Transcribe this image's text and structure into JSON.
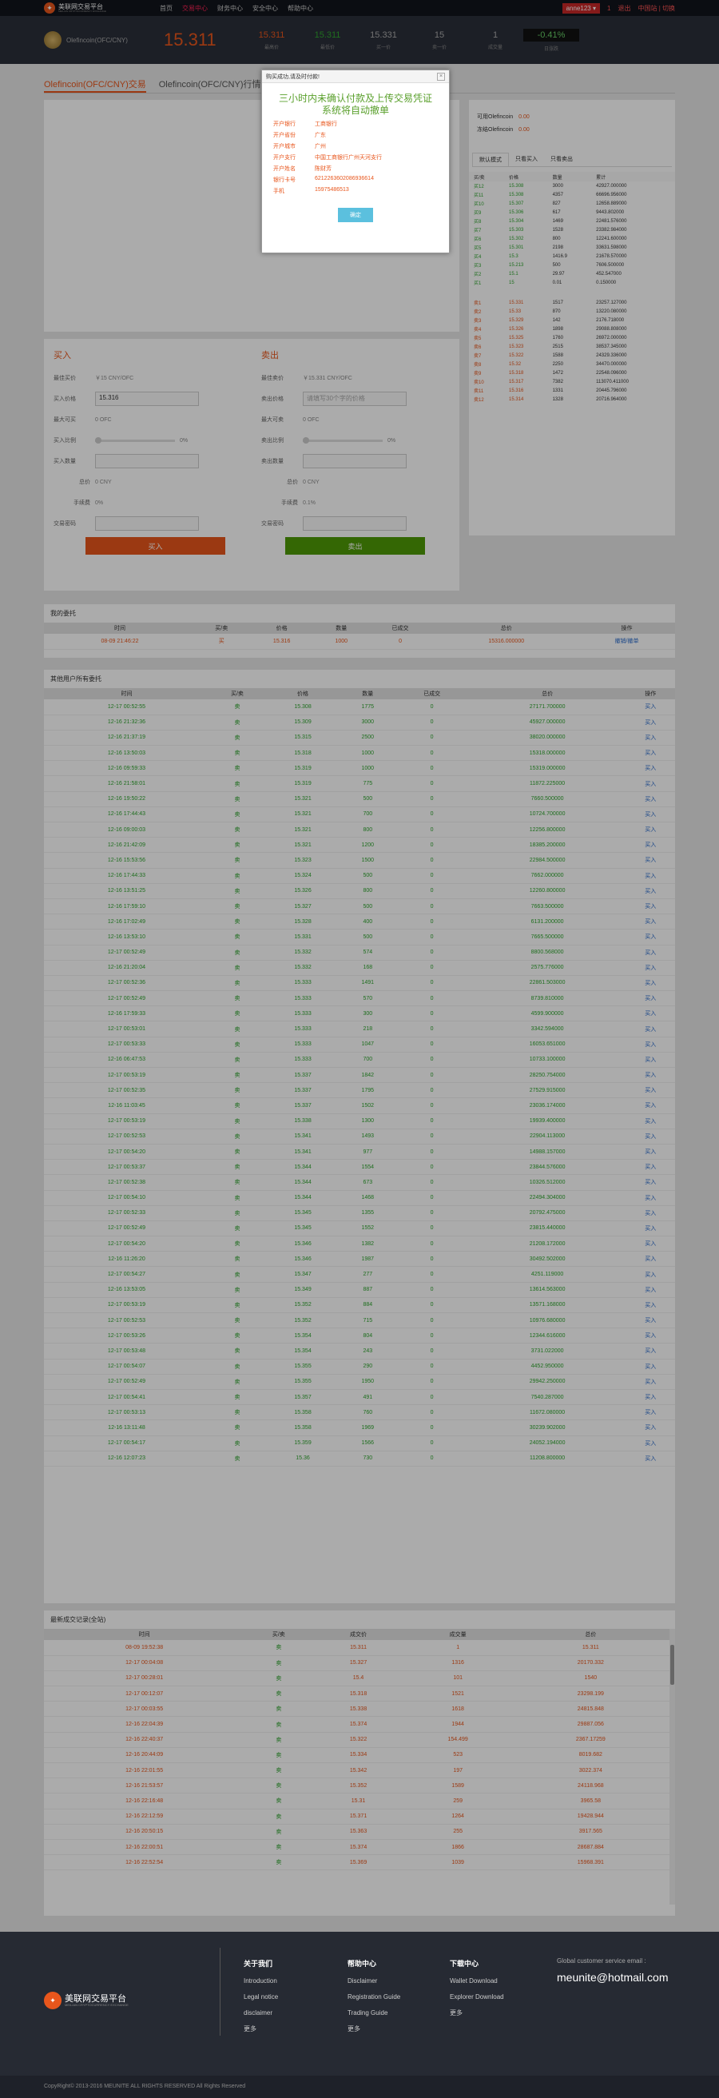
{
  "topbar": {
    "logo_text": "美联网交易平台",
    "logo_sub": "MEILIAN CRYPTOCURRENCY EXCHANGE",
    "nav": [
      "首页",
      "交易中心",
      "财务中心",
      "安全中心",
      "帮助中心"
    ],
    "user": "anne123",
    "link1": "1",
    "logout": "退出",
    "lang": "中国站 | 切换",
    "hex_user_bg": "#c62828"
  },
  "pricebar": {
    "coin": "Olefincoin(OFC/CNY)",
    "price": "15.311",
    "stats": [
      {
        "v": "15.311",
        "l": "最高价",
        "c": "red"
      },
      {
        "v": "15.311",
        "l": "最低价",
        "c": "green"
      },
      {
        "v": "15.331",
        "l": "买一价",
        "c": "gray"
      },
      {
        "v": "15",
        "l": "卖一价",
        "c": "gray"
      },
      {
        "v": "1",
        "l": "成交量",
        "c": "gray"
      },
      {
        "v": "-0.41%",
        "l": "日涨跌",
        "c": "pct"
      }
    ]
  },
  "tabs": [
    "Olefincoin(OFC/CNY)交易",
    "Olefincoin(OFC/CNY)行情"
  ],
  "modal": {
    "title": "购买成功,请及时付款!",
    "close": "×",
    "notice": "三小时内未确认付款及上传交易凭证系统将自动撤单",
    "fields": [
      {
        "k": "开户银行",
        "v": "工商银行"
      },
      {
        "k": "开户省份",
        "v": "广东"
      },
      {
        "k": "开户城市",
        "v": "广州"
      },
      {
        "k": "开户支行",
        "v": "中国工商银行广州天河支行"
      },
      {
        "k": "开户姓名",
        "v": "陈财芳"
      },
      {
        "k": "银行卡号",
        "v": "6212263602086936614"
      },
      {
        "k": "手机",
        "v": "15975486513"
      }
    ],
    "ok": "确定"
  },
  "balance": {
    "rows": [
      {
        "k": "可用Olefincoin",
        "v": "0.00"
      },
      {
        "k": "冻结Olefincoin",
        "v": "0.00"
      }
    ]
  },
  "ob_tabs": [
    "默认模式",
    "只看买入",
    "只看卖出"
  ],
  "ob_headers": [
    "买/卖",
    "价格",
    "数量",
    "累计"
  ],
  "ob_buy": [
    [
      "买12",
      "15.308",
      "3000",
      "42927.000000"
    ],
    [
      "买11",
      "15.308",
      "4357",
      "66696.956000"
    ],
    [
      "买10",
      "15.307",
      "827",
      "12658.889000"
    ],
    [
      "买9",
      "15.306",
      "617",
      "9443.802000"
    ],
    [
      "买8",
      "15.304",
      "1469",
      "22481.576000"
    ],
    [
      "买7",
      "15.303",
      "1528",
      "23382.984000"
    ],
    [
      "买6",
      "15.302",
      "800",
      "12241.600000"
    ],
    [
      "买5",
      "15.301",
      "2198",
      "33631.598000"
    ],
    [
      "买4",
      "15.3",
      "1416.9",
      "21678.570000"
    ],
    [
      "买3",
      "15.213",
      "500",
      "7606.500000"
    ],
    [
      "买2",
      "15.1",
      "29.97",
      "452.547000"
    ],
    [
      "买1",
      "15",
      "0.01",
      "0.150000"
    ]
  ],
  "ob_sell": [
    [
      "卖1",
      "15.331",
      "1517",
      "23257.127000"
    ],
    [
      "卖2",
      "15.33",
      "870",
      "13220.080000"
    ],
    [
      "卖3",
      "15.329",
      "142",
      "2176.718000"
    ],
    [
      "卖4",
      "15.326",
      "1898",
      "29088.808000"
    ],
    [
      "卖5",
      "15.325",
      "1760",
      "26972.000000"
    ],
    [
      "卖6",
      "15.323",
      "2515",
      "38537.345000"
    ],
    [
      "卖7",
      "15.322",
      "1588",
      "24329.336000"
    ],
    [
      "卖8",
      "15.32",
      "2250",
      "34470.000000"
    ],
    [
      "卖9",
      "15.318",
      "1472",
      "22548.096000"
    ],
    [
      "卖10",
      "15.317",
      "7382",
      "113070.411000"
    ],
    [
      "卖11",
      "15.316",
      "1331",
      "20445.796000"
    ],
    [
      "卖12",
      "15.314",
      "1328",
      "20716.964000"
    ]
  ],
  "buy_form": {
    "title": "买入",
    "best": "最佳买价",
    "best_val": "￥15 CNY/OFC",
    "price_lbl": "买入价格",
    "price_val": "15.316",
    "max_lbl": "最大可买",
    "max_val": "0 OFC",
    "ratio_lbl": "买入比例",
    "ratio_val": "0%",
    "qty_lbl": "买入数量",
    "total_lbl": "总价",
    "total_val": "0 CNY",
    "fee_lbl": "手续费",
    "fee_val": "0%",
    "pwd_lbl": "交易密码",
    "btn": "买入"
  },
  "sell_form": {
    "title": "卖出",
    "best": "最佳卖价",
    "best_val": "￥15.331 CNY/OFC",
    "price_lbl": "卖出价格",
    "price_ph": "请填写30个字的价格",
    "max_lbl": "最大可卖",
    "max_val": "0 OFC",
    "ratio_lbl": "卖出比例",
    "ratio_val": "0%",
    "qty_lbl": "卖出数量",
    "total_lbl": "总价",
    "total_val": "0 CNY",
    "fee_lbl": "手续费",
    "fee_val": "0.1%",
    "pwd_lbl": "交易密码",
    "btn": "卖出"
  },
  "my_orders": {
    "title": "我的委托",
    "headers": [
      "时间",
      "买/卖",
      "价格",
      "数量",
      "已成交",
      "总价",
      "操作"
    ],
    "rows": [
      [
        "08-09 21:46:22",
        "买",
        "15.316",
        "1000",
        "0",
        "15316.000000",
        "撤销/撤单"
      ]
    ]
  },
  "others": {
    "title": "其他用户所有委托",
    "headers": [
      "时间",
      "买/卖",
      "价格",
      "数量",
      "已成交",
      "总价",
      "操作"
    ],
    "rows": [
      [
        "12-17 00:52:55",
        "卖",
        "15.308",
        "1775",
        "0",
        "27171.700000",
        "买入"
      ],
      [
        "12-16 21:32:36",
        "卖",
        "15.309",
        "3000",
        "0",
        "45927.000000",
        "买入"
      ],
      [
        "12-16 21:37:19",
        "卖",
        "15.315",
        "2500",
        "0",
        "38020.000000",
        "买入"
      ],
      [
        "12-16 13:50:03",
        "卖",
        "15.318",
        "1000",
        "0",
        "15318.000000",
        "买入"
      ],
      [
        "12-16 09:59:33",
        "卖",
        "15.319",
        "1000",
        "0",
        "15319.000000",
        "买入"
      ],
      [
        "12-16 21:58:01",
        "卖",
        "15.319",
        "775",
        "0",
        "11872.225000",
        "买入"
      ],
      [
        "12-16 19:50:22",
        "卖",
        "15.321",
        "500",
        "0",
        "7660.500000",
        "买入"
      ],
      [
        "12-16 17:44:43",
        "卖",
        "15.321",
        "700",
        "0",
        "10724.700000",
        "买入"
      ],
      [
        "12-16 09:00:03",
        "卖",
        "15.321",
        "800",
        "0",
        "12256.800000",
        "买入"
      ],
      [
        "12-16 21:42:09",
        "卖",
        "15.321",
        "1200",
        "0",
        "18385.200000",
        "买入"
      ],
      [
        "12-16 15:53:56",
        "卖",
        "15.323",
        "1500",
        "0",
        "22984.500000",
        "买入"
      ],
      [
        "12-16 17:44:33",
        "卖",
        "15.324",
        "500",
        "0",
        "7662.000000",
        "买入"
      ],
      [
        "12-16 13:51:25",
        "卖",
        "15.326",
        "800",
        "0",
        "12260.800000",
        "买入"
      ],
      [
        "12-16 17:59:10",
        "卖",
        "15.327",
        "500",
        "0",
        "7663.500000",
        "买入"
      ],
      [
        "12-16 17:02:49",
        "卖",
        "15.328",
        "400",
        "0",
        "6131.200000",
        "买入"
      ],
      [
        "12-16 13:53:10",
        "卖",
        "15.331",
        "500",
        "0",
        "7665.500000",
        "买入"
      ],
      [
        "12-17 00:52:49",
        "卖",
        "15.332",
        "574",
        "0",
        "8800.568000",
        "买入"
      ],
      [
        "12-16 21:20:04",
        "卖",
        "15.332",
        "168",
        "0",
        "2575.776000",
        "买入"
      ],
      [
        "12-17 00:52:36",
        "卖",
        "15.333",
        "1491",
        "0",
        "22861.503000",
        "买入"
      ],
      [
        "12-17 00:52:49",
        "卖",
        "15.333",
        "570",
        "0",
        "8739.810000",
        "买入"
      ],
      [
        "12-16 17:59:33",
        "卖",
        "15.333",
        "300",
        "0",
        "4599.900000",
        "买入"
      ],
      [
        "12-17 00:53:01",
        "卖",
        "15.333",
        "218",
        "0",
        "3342.594000",
        "买入"
      ],
      [
        "12-17 00:53:33",
        "卖",
        "15.333",
        "1047",
        "0",
        "16053.651000",
        "买入"
      ],
      [
        "12-16 06:47:53",
        "卖",
        "15.333",
        "700",
        "0",
        "10733.100000",
        "买入"
      ],
      [
        "12-17 00:53:19",
        "卖",
        "15.337",
        "1842",
        "0",
        "28250.754000",
        "买入"
      ],
      [
        "12-17 00:52:35",
        "卖",
        "15.337",
        "1795",
        "0",
        "27529.915000",
        "买入"
      ],
      [
        "12-16 11:03:45",
        "卖",
        "15.337",
        "1502",
        "0",
        "23036.174000",
        "买入"
      ],
      [
        "12-17 00:53:19",
        "卖",
        "15.338",
        "1300",
        "0",
        "19939.400000",
        "买入"
      ],
      [
        "12-17 00:52:53",
        "卖",
        "15.341",
        "1493",
        "0",
        "22904.113000",
        "买入"
      ],
      [
        "12-17 00:54:20",
        "卖",
        "15.341",
        "977",
        "0",
        "14988.157000",
        "买入"
      ],
      [
        "12-17 00:53:37",
        "卖",
        "15.344",
        "1554",
        "0",
        "23844.576000",
        "买入"
      ],
      [
        "12-17 00:52:38",
        "卖",
        "15.344",
        "673",
        "0",
        "10326.512000",
        "买入"
      ],
      [
        "12-17 00:54:10",
        "卖",
        "15.344",
        "1468",
        "0",
        "22494.304000",
        "买入"
      ],
      [
        "12-17 00:52:33",
        "卖",
        "15.345",
        "1355",
        "0",
        "20792.475000",
        "买入"
      ],
      [
        "12-17 00:52:49",
        "卖",
        "15.345",
        "1552",
        "0",
        "23815.440000",
        "买入"
      ],
      [
        "12-17 00:54:20",
        "卖",
        "15.346",
        "1382",
        "0",
        "21208.172000",
        "买入"
      ],
      [
        "12-16 11:26:20",
        "卖",
        "15.346",
        "1987",
        "0",
        "30492.502000",
        "买入"
      ],
      [
        "12-17 00:54:27",
        "卖",
        "15.347",
        "277",
        "0",
        "4251.119000",
        "买入"
      ],
      [
        "12-16 13:53:05",
        "卖",
        "15.349",
        "887",
        "0",
        "13614.563000",
        "买入"
      ],
      [
        "12-17 00:53:19",
        "卖",
        "15.352",
        "884",
        "0",
        "13571.168000",
        "买入"
      ],
      [
        "12-17 00:52:53",
        "卖",
        "15.352",
        "715",
        "0",
        "10976.680000",
        "买入"
      ],
      [
        "12-17 00:53:26",
        "卖",
        "15.354",
        "804",
        "0",
        "12344.616000",
        "买入"
      ],
      [
        "12-17 00:53:48",
        "卖",
        "15.354",
        "243",
        "0",
        "3731.022000",
        "买入"
      ],
      [
        "12-17 00:54:07",
        "卖",
        "15.355",
        "290",
        "0",
        "4452.950000",
        "买入"
      ],
      [
        "12-17 00:52:49",
        "卖",
        "15.355",
        "1950",
        "0",
        "29942.250000",
        "买入"
      ],
      [
        "12-17 00:54:41",
        "卖",
        "15.357",
        "491",
        "0",
        "7540.287000",
        "买入"
      ],
      [
        "12-17 00:53:13",
        "卖",
        "15.358",
        "760",
        "0",
        "11672.080000",
        "买入"
      ],
      [
        "12-16 13:11:48",
        "卖",
        "15.358",
        "1969",
        "0",
        "30239.902000",
        "买入"
      ],
      [
        "12-17 00:54:17",
        "卖",
        "15.359",
        "1566",
        "0",
        "24052.194000",
        "买入"
      ],
      [
        "12-16 12:07:23",
        "卖",
        "15.36",
        "730",
        "0",
        "11208.800000",
        "买入"
      ]
    ]
  },
  "recent": {
    "title": "最新成交记录(全站)",
    "headers": [
      "时间",
      "买/卖",
      "成交价",
      "成交量",
      "总价"
    ],
    "rows": [
      [
        "08-09 19:52:38",
        "卖",
        "15.311",
        "1",
        "15.311"
      ],
      [
        "12-17 00:04:08",
        "卖",
        "15.327",
        "1316",
        "20170.332"
      ],
      [
        "12-17 00:28:01",
        "卖",
        "15.4",
        "101",
        "1540"
      ],
      [
        "12-17 00:12:07",
        "卖",
        "15.318",
        "1521",
        "23298.199"
      ],
      [
        "12-17 00:03:55",
        "卖",
        "15.338",
        "1618",
        "24815.848"
      ],
      [
        "12-16 22:04:39",
        "卖",
        "15.374",
        "1944",
        "29887.056"
      ],
      [
        "12-16 22:40:37",
        "卖",
        "15.322",
        "154.499",
        "2367.17259"
      ],
      [
        "12-16 20:44:09",
        "卖",
        "15.334",
        "523",
        "8019.682"
      ],
      [
        "12-16 22:01:55",
        "卖",
        "15.342",
        "197",
        "3022.374"
      ],
      [
        "12-16 21:53:57",
        "卖",
        "15.352",
        "1589",
        "24118.968"
      ],
      [
        "12-16 22:16:48",
        "卖",
        "15.31",
        "259",
        "3965.58"
      ],
      [
        "12-16 22:12:59",
        "卖",
        "15.371",
        "1264",
        "19428.944"
      ],
      [
        "12-16 20:50:15",
        "卖",
        "15.363",
        "255",
        "3917.565"
      ],
      [
        "12-16 22:00:51",
        "卖",
        "15.374",
        "1866",
        "28687.884"
      ],
      [
        "12-16 22:52:54",
        "卖",
        "15.369",
        "1039",
        "15968.391"
      ]
    ]
  },
  "footer": {
    "logo": "美联网交易平台",
    "logo_sub": "MEILIAN CRYPTOCURRENCY EXCHANGE",
    "cols": [
      {
        "h": "关于我们",
        "items": [
          "Introduction",
          "Legal notice",
          "disclaimer",
          "更多"
        ]
      },
      {
        "h": "帮助中心",
        "items": [
          "Disclaimer",
          "Registration Guide",
          "Trading Guide",
          "更多"
        ]
      },
      {
        "h": "下载中心",
        "items": [
          "Wallet Download",
          "Explorer Download",
          "更多"
        ]
      }
    ],
    "service_label": "Global customer service email :",
    "email": "meunite@hotmail.com",
    "copyright": "CopyRight© 2013-2016 MEUNITE ALL RIGHTS RESERVED All Rights Reserved"
  }
}
